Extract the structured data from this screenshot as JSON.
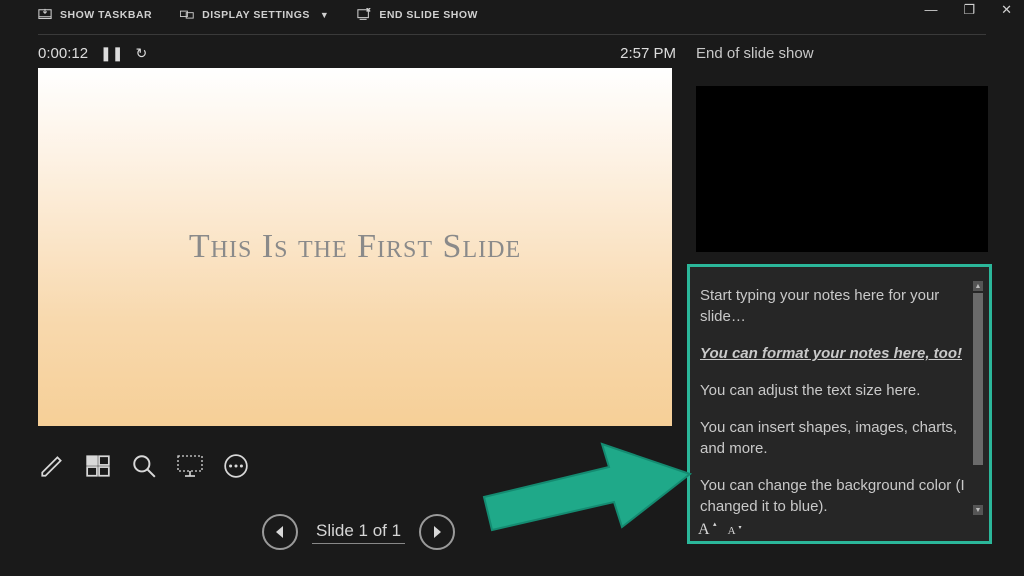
{
  "toolbar": {
    "show_taskbar": "SHOW TASKBAR",
    "display_settings": "DISPLAY SETTINGS",
    "end_slide_show": "END SLIDE SHOW"
  },
  "timer": {
    "elapsed": "0:00:12"
  },
  "clock": {
    "time": "2:57 PM"
  },
  "next_slide": {
    "label": "End of slide show"
  },
  "current_slide": {
    "title": "This Is the First Slide"
  },
  "notes": {
    "p1": "Start typing your notes here for your slide…",
    "p2": "You can format your notes here, too!",
    "p3": "You can adjust the text size here.",
    "p4": "You can insert shapes, images, charts, and more.",
    "p5": "You can change the background color (I changed it to blue)."
  },
  "nav": {
    "slide_indicator": "Slide 1 of 1"
  }
}
